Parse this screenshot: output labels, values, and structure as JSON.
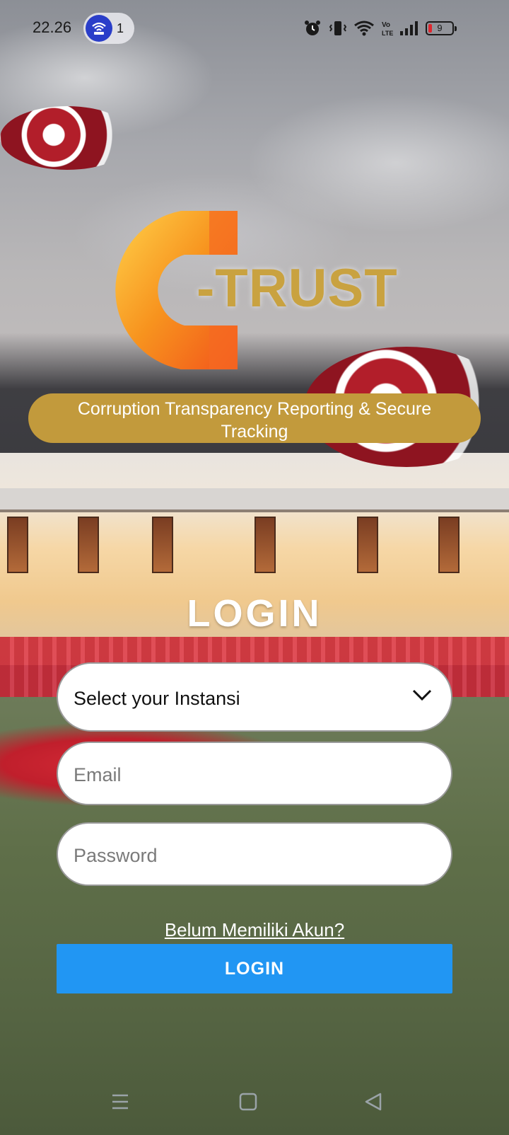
{
  "status_bar": {
    "time": "22.26",
    "hotspot_count": "1",
    "battery_level": "9",
    "icons": [
      "hotspot-icon",
      "alarm-icon",
      "vibrate-icon",
      "wifi-icon",
      "volte-icon",
      "signal-icon",
      "battery-icon"
    ]
  },
  "logo": {
    "mark": "C",
    "text": "-TRUST",
    "tagline": "Corruption Transparency Reporting & Secure Tracking"
  },
  "form": {
    "title": "LOGIN",
    "instansi_select": "Select your Instansi",
    "email_placeholder": "Email",
    "password_placeholder": "Password",
    "signup_link": "Belum Memiliki Akun?",
    "login_button": "LOGIN"
  },
  "nav_bar": {
    "icons": [
      "menu-icon",
      "home-icon",
      "back-icon"
    ]
  },
  "colors": {
    "accent_gold": "#c29a3c",
    "login_button": "#2196f3",
    "logo_orange": "#f7931e"
  }
}
